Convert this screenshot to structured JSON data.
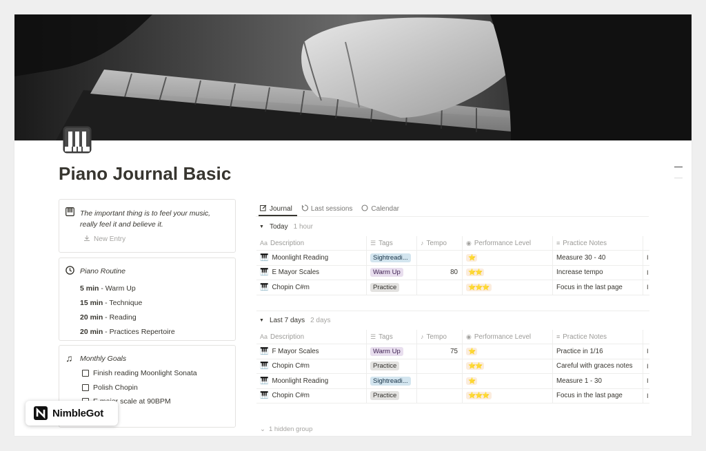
{
  "page": {
    "title": "Piano Journal Basic"
  },
  "callouts": {
    "quote": {
      "text": "The important thing is to feel your music, really feel it and believe it.",
      "new_entry": "New Entry"
    },
    "routine": {
      "heading": "Piano Routine",
      "items": [
        {
          "time": "5 min",
          "task": " - Warm Up"
        },
        {
          "time": "15 min",
          "task": " - Technique"
        },
        {
          "time": "20 min",
          "task": " - Reading"
        },
        {
          "time": "20 min",
          "task": " - Practices Repertoire"
        }
      ]
    },
    "goals": {
      "heading": "Monthly Goals",
      "items": [
        "Finish reading Moonlight Sonata",
        "Polish Chopin",
        "E major scale at 90BPM"
      ]
    }
  },
  "badge": {
    "text": "NimbleGot"
  },
  "tabs": [
    {
      "label": "Journal",
      "icon": "edit-icon"
    },
    {
      "label": "Last sessions",
      "icon": "history-icon"
    },
    {
      "label": "Calendar",
      "icon": "calendar-icon"
    }
  ],
  "columns": {
    "description": "Description",
    "tags": "Tags",
    "tempo": "Tempo",
    "performance": "Performance Level",
    "notes": "Practice Notes"
  },
  "groups": [
    {
      "name": "Today",
      "count": "1 hour",
      "rows": [
        {
          "description": "Moonlight Reading",
          "tag": "Sightreadi...",
          "tag_type": "sight",
          "tempo": "",
          "stars": "⭐",
          "notes": "Measure 30 - 40"
        },
        {
          "description": "E Mayor Scales",
          "tag": "Warm Up",
          "tag_type": "warm",
          "tempo": "80",
          "stars": "⭐⭐",
          "notes": "Increase tempo"
        },
        {
          "description": "Chopin C#m",
          "tag": "Practice",
          "tag_type": "prac",
          "tempo": "",
          "stars": "⭐⭐⭐",
          "notes": "Focus in the last page"
        }
      ]
    },
    {
      "name": "Last 7 days",
      "count": "2 days",
      "rows": [
        {
          "description": "F Mayor Scales",
          "tag": "Warm Up",
          "tag_type": "warm",
          "tempo": "75",
          "stars": "⭐",
          "notes": "Practice in 1/16"
        },
        {
          "description": "Chopin C#m",
          "tag": "Practice",
          "tag_type": "prac",
          "tempo": "",
          "stars": "⭐⭐",
          "notes": "Careful with graces notes"
        },
        {
          "description": "Moonlight Reading",
          "tag": "Sightreadi...",
          "tag_type": "sight",
          "tempo": "",
          "stars": "⭐",
          "notes": "Measure 1 - 30"
        },
        {
          "description": "Chopin C#m",
          "tag": "Practice",
          "tag_type": "prac",
          "tempo": "",
          "stars": "⭐⭐⭐",
          "notes": "Focus in the last page"
        }
      ]
    }
  ],
  "hidden_group": "1 hidden group",
  "colors": {
    "tag_sight_bg": "#d3e5ef",
    "tag_warm_bg": "#e8deee",
    "tag_practice_bg": "#e3e2e0",
    "text": "#37352f",
    "muted": "#9b9a97"
  }
}
